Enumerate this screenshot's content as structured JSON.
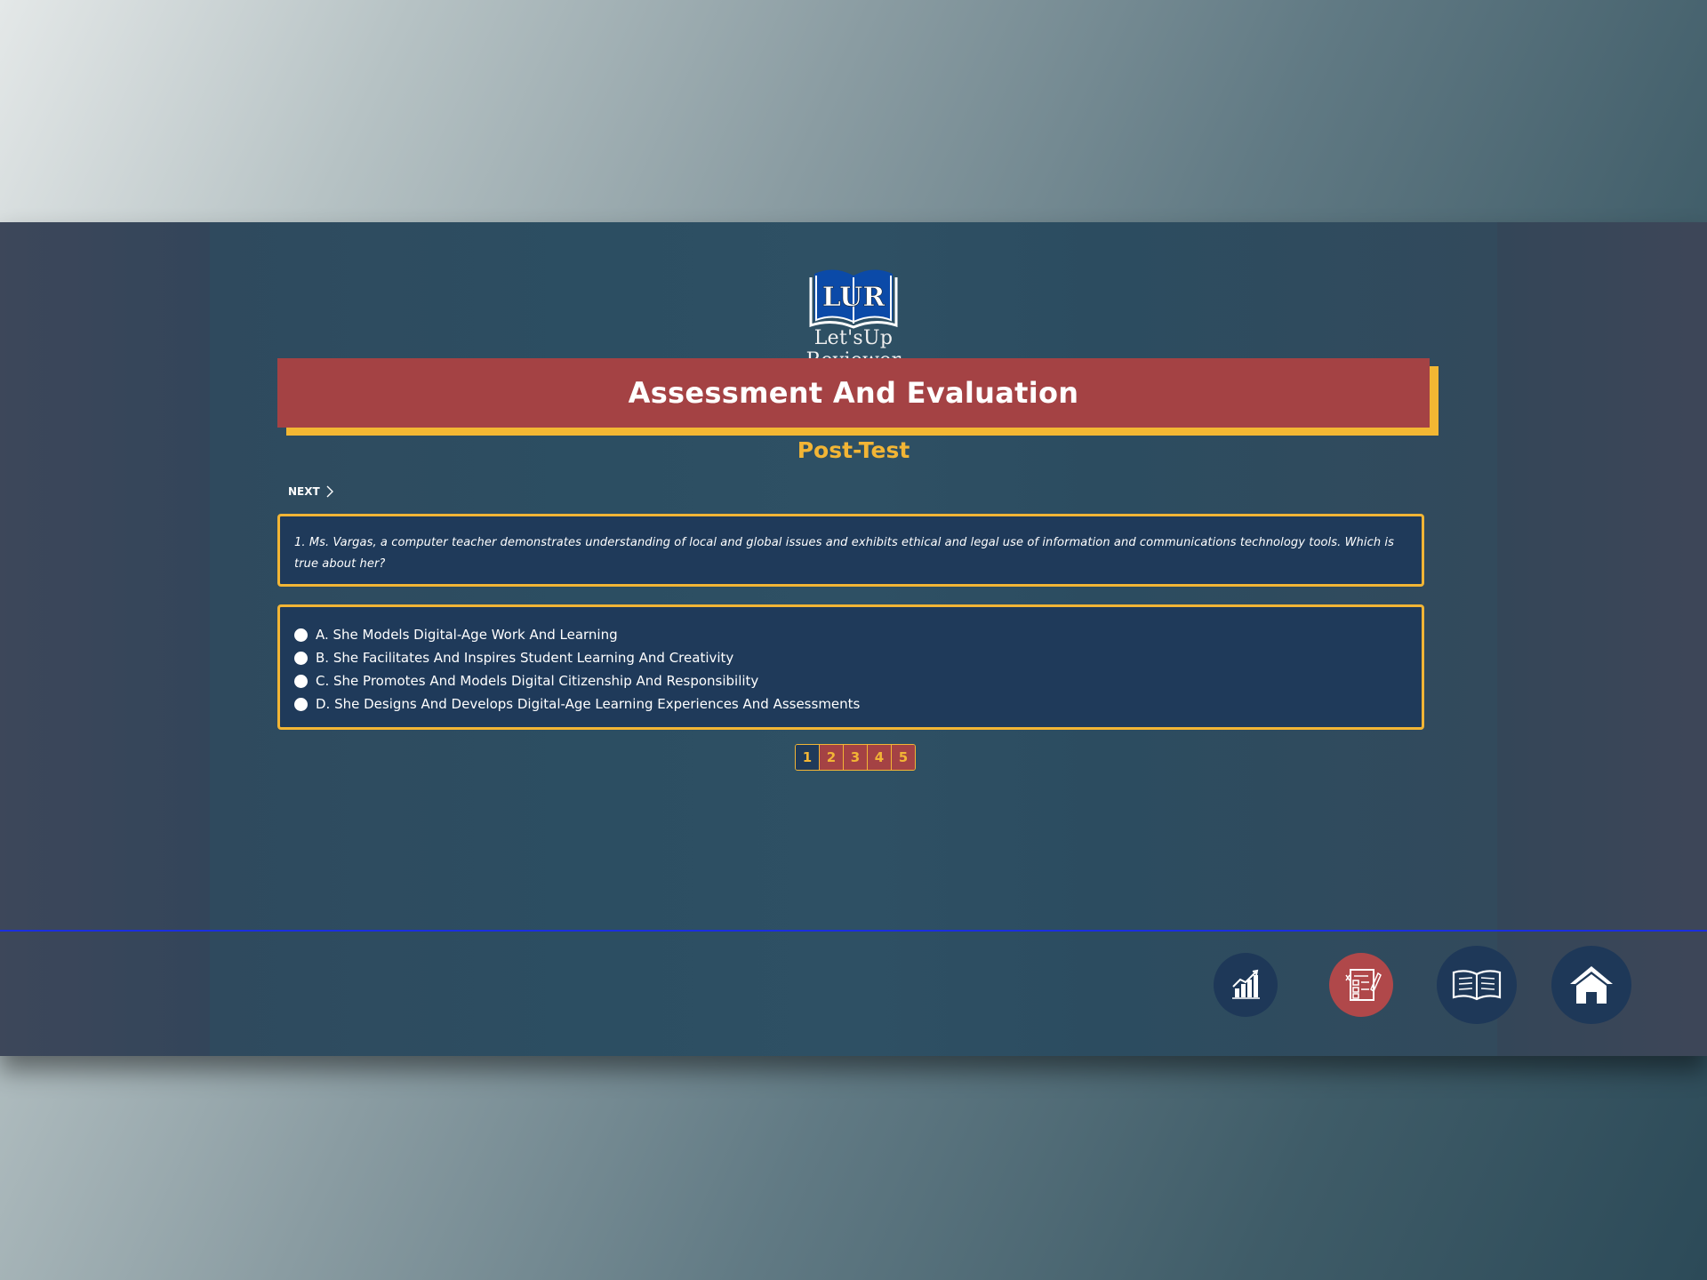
{
  "brand": {
    "logo_text": "LUR",
    "name": "Let'sUp Reviewer"
  },
  "header": {
    "title": "Assessment And Evaluation",
    "subtitle": "Post-Test"
  },
  "nav": {
    "next_label": "NEXT"
  },
  "question": {
    "text": "1. Ms. Vargas, a computer teacher demonstrates understanding of local and global issues and exhibits ethical and legal use of information and communications technology tools. Which is true about her?",
    "options": [
      "A. She Models Digital-Age Work And Learning",
      "B. She Facilitates And Inspires Student Learning And Creativity",
      "C. She Promotes And Models Digital Citizenship And Responsibility",
      "D. She Designs And Develops Digital-Age Learning Experiences And Assessments"
    ]
  },
  "pagination": {
    "pages": [
      "1",
      "2",
      "3",
      "4",
      "5"
    ],
    "current": "1"
  },
  "bottom_nav": [
    {
      "icon": "bar-chart-icon",
      "active": false
    },
    {
      "icon": "exam-sheet-icon",
      "active": true
    },
    {
      "icon": "open-book-icon",
      "active": false
    },
    {
      "icon": "home-icon",
      "active": false
    }
  ],
  "colors": {
    "accent": "#f2b535",
    "title_bg": "#a44244",
    "panel_bg": "#1f3a5a",
    "divider": "#1a2ee0"
  }
}
